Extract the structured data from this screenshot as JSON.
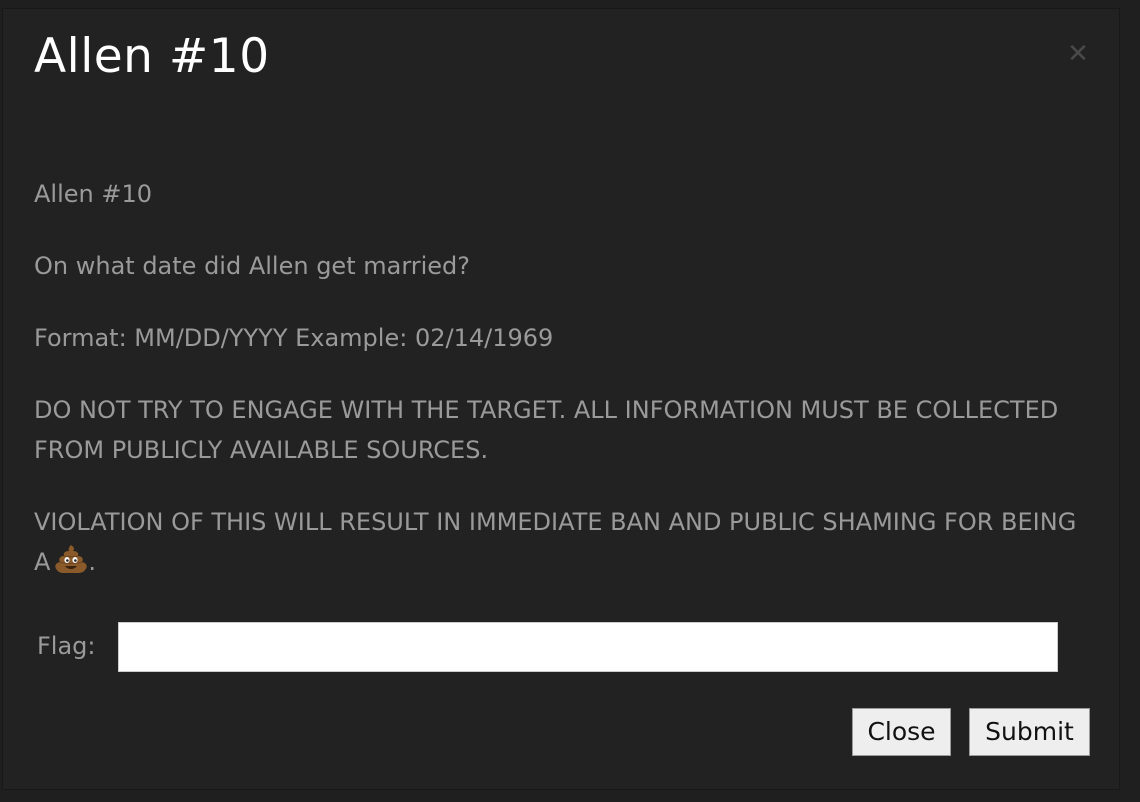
{
  "modal": {
    "title": "Allen #10",
    "close_icon": "close-icon",
    "paragraphs": {
      "name": "Allen #10",
      "question": "On what date did Allen get married?",
      "format": "Format: MM/DD/YYYY Example: 02/14/1969",
      "warning": "DO NOT TRY TO ENGAGE WITH THE TARGET. ALL INFORMATION MUST BE COLLECTED FROM PUBLICLY AVAILABLE SOURCES.",
      "violation": "VIOLATION OF THIS WILL RESULT IN IMMEDIATE BAN AND PUBLIC SHAMING FOR BEING A",
      "violation_end": ".",
      "violation_icon": "pile-of-poo-icon"
    },
    "flag": {
      "label": "Flag:",
      "value": "",
      "placeholder": ""
    },
    "buttons": {
      "close_label": "Close",
      "submit_label": "Submit"
    }
  },
  "colors": {
    "background": "#222222",
    "title": "#ffffff",
    "body_text": "#9a9a9a",
    "button_bg": "#eeeeee"
  }
}
